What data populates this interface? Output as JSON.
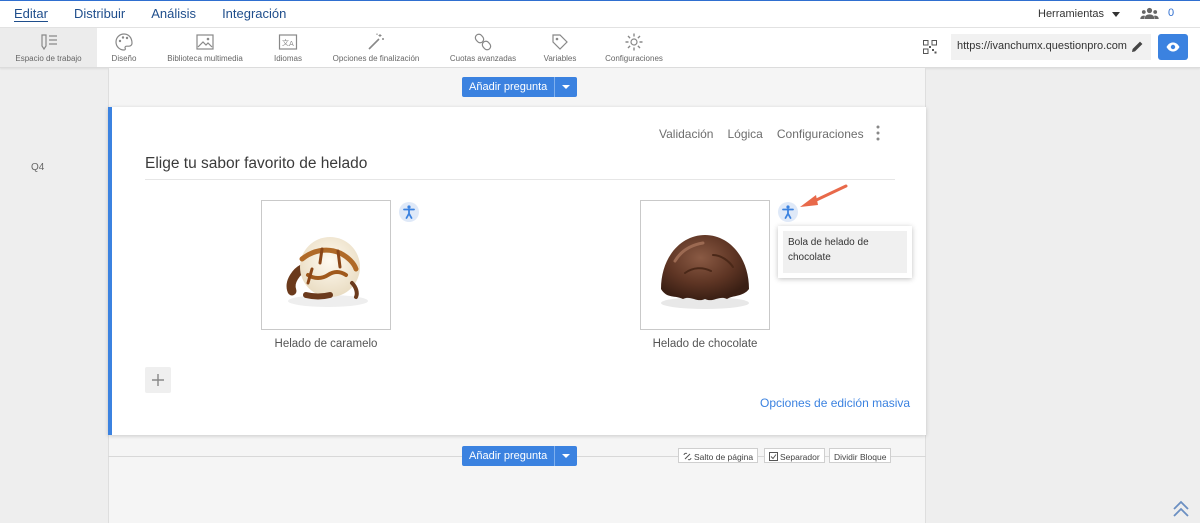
{
  "nav": {
    "menu": [
      "Editar",
      "Distribuir",
      "Análisis",
      "Integración"
    ],
    "tools_label": "Herramientas",
    "users_count": "0"
  },
  "toolbar": {
    "items": [
      "Espacio de trabajo",
      "Diseño",
      "Biblioteca multimedia",
      "Idiomas",
      "Opciones de finalización",
      "Cuotas avanzadas",
      "Variables",
      "Configuraciones"
    ],
    "url": "https://ivanchumx.questionpro.com"
  },
  "editor": {
    "add_question": "Añadir pregunta",
    "question_number": "Q4",
    "actions": [
      "Validación",
      "Lógica",
      "Configuraciones"
    ],
    "question_title": "Elige tu sabor favorito de helado",
    "options": [
      {
        "caption": "Helado de caramelo"
      },
      {
        "caption": "Helado de chocolate"
      }
    ],
    "alt_text": "Bola de helado de chocolate",
    "bulk_edit": "Opciones de edición masiva",
    "page_break": "Salto de página",
    "separator": "Separador",
    "split_block": "Dividir Bloque"
  },
  "colors": {
    "accent": "#3b82e0",
    "nav_text": "#1f4e8c",
    "arrow": "#e8694a"
  }
}
